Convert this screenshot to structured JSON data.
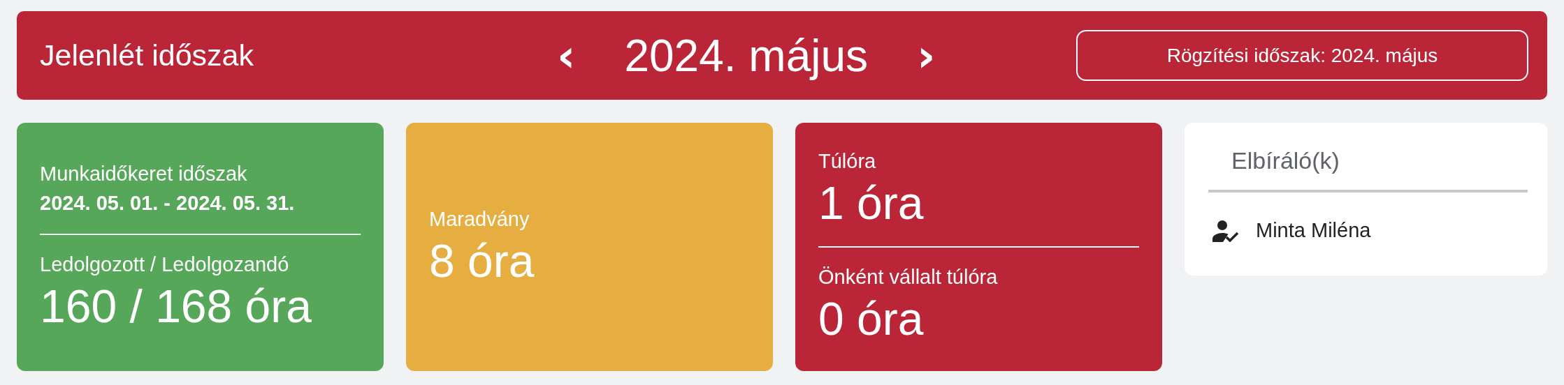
{
  "header": {
    "title": "Jelenlét időszak",
    "prev": "‹",
    "month": "2024. május",
    "next": "›",
    "period_button": "Rögzítési időszak: 2024. május"
  },
  "cards": [
    {
      "kind": "stat",
      "color": "#57a75a",
      "sections": [
        {
          "label": "Munkaidőkeret időszak",
          "period": "2024. 05. 01. - 2024. 05. 31."
        },
        {
          "label": "Ledolgozott / Ledolgozandó",
          "value": "160 / 168 óra"
        }
      ]
    },
    {
      "kind": "stat",
      "color": "#e6ae41",
      "sections": [
        {
          "label": "Maradvány",
          "value": "8 óra"
        }
      ]
    },
    {
      "kind": "stat",
      "color": "#ba2538",
      "sections": [
        {
          "label": "Túlóra",
          "value": "1 óra"
        },
        {
          "label": "Önként vállalt túlóra",
          "value": "0 óra"
        }
      ]
    },
    {
      "kind": "reviewers",
      "title": "Elbíráló(k)",
      "people": [
        {
          "name": "Minta Miléna"
        }
      ]
    }
  ]
}
